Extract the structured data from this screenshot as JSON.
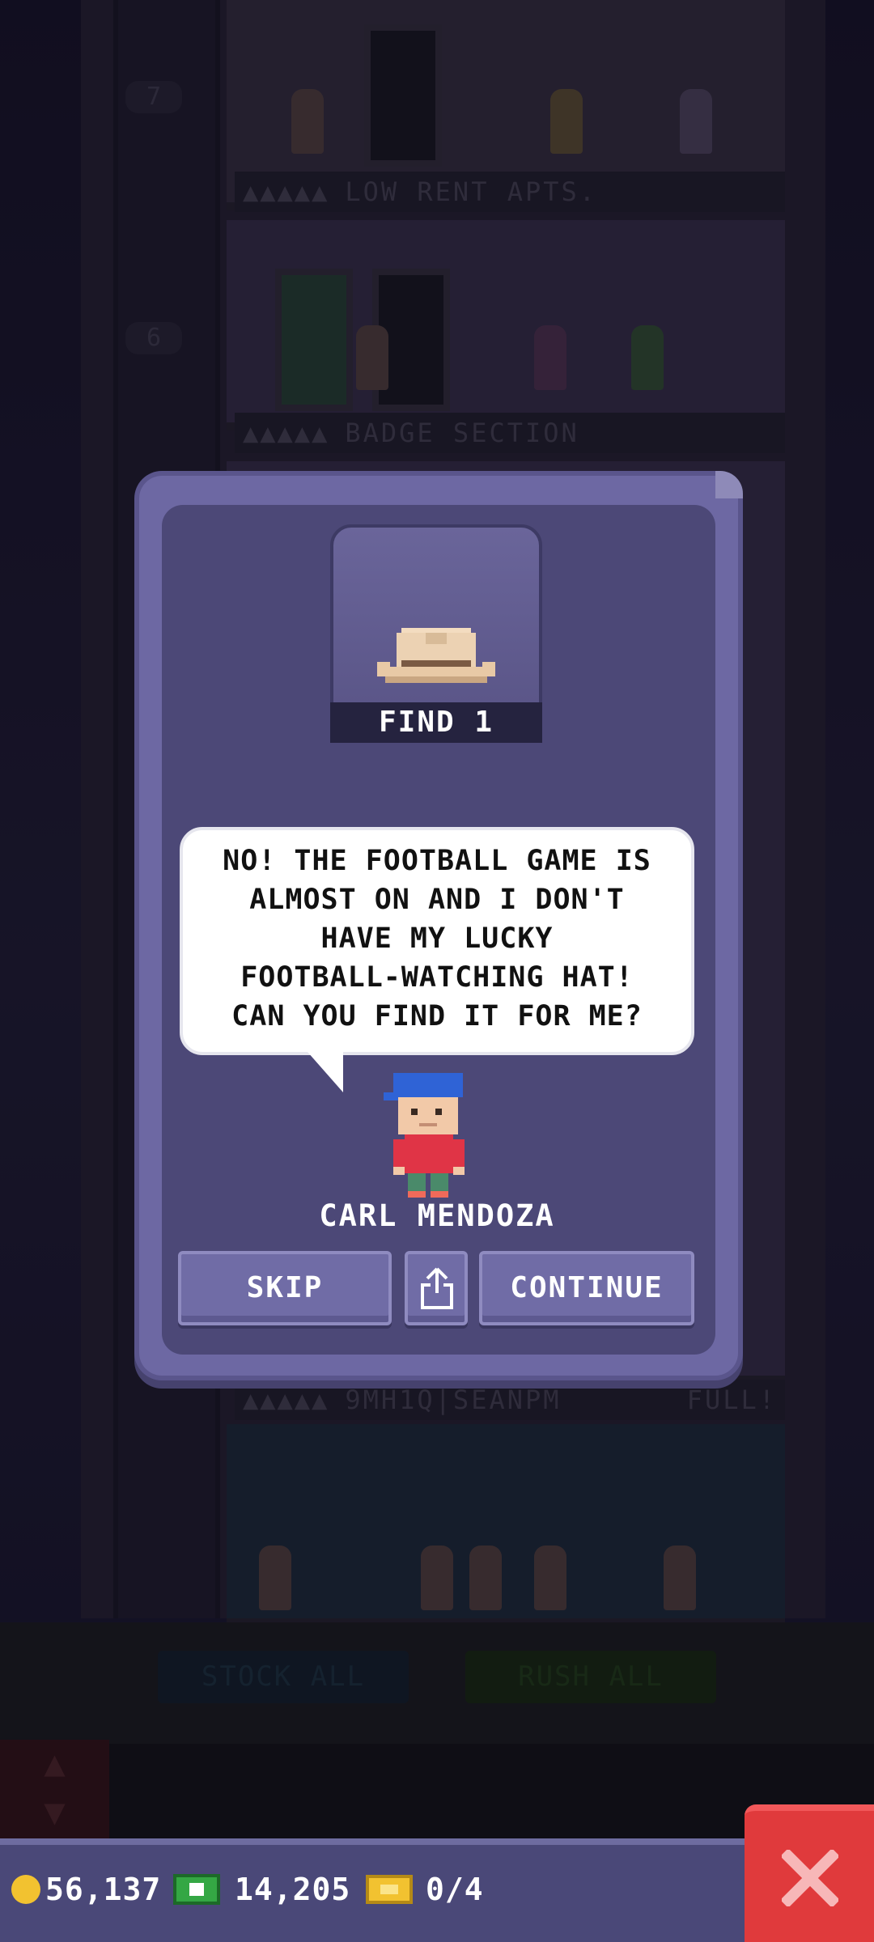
{
  "background": {
    "floor_numbers": [
      "7",
      "6"
    ],
    "floors": [
      {
        "label": "LOW RENT APTS.",
        "dots": "▲▲▲▲▲",
        "status": ""
      },
      {
        "label": "BADGE SECTION",
        "dots": "▲▲▲▲▲",
        "status": ""
      },
      {
        "label": "9MH1Q|SEANPM",
        "dots": "▲▲▲▲▲",
        "status": "FULL!"
      }
    ],
    "stock_all_label": "STOCK ALL",
    "rush_all_label": "RUSH ALL"
  },
  "mission": {
    "item_icon": "cowboy-hat-icon",
    "item_caption": "FIND 1",
    "speech": "NO! THE FOOTBALL GAME IS\nALMOST ON AND I DON'T\nHAVE MY LUCKY\nFOOTBALL-WATCHING HAT!\nCAN YOU FIND IT FOR ME?",
    "character_name": "CARL MENDOZA",
    "buttons": {
      "skip": "SKIP",
      "share_icon": "share-icon",
      "continue": "CONTINUE"
    }
  },
  "hud": {
    "coins": "56,137",
    "bux": "14,205",
    "tickets": "0/4"
  },
  "colors": {
    "dialog_frame": "#6d68a3",
    "dialog_inner": "#4c4877",
    "hud_bar": "#4a4878",
    "close_button": "#e03a3c",
    "coin": "#f2c230",
    "bux": "#34a744"
  }
}
